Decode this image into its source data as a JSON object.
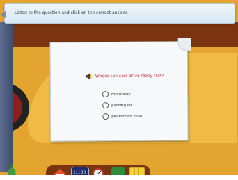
{
  "instruction": {
    "text": "Listen to the question and click on the correct answer."
  },
  "question": {
    "text": "Where can cars drive really fast?"
  },
  "options": [
    {
      "label": "motorway"
    },
    {
      "label": "parking lot"
    },
    {
      "label": "pedestrian zone"
    }
  ],
  "toolbar": {
    "clock_text": "11:00"
  },
  "colors": {
    "question_text": "#c3303c",
    "wall": "#7a3510",
    "floor": "#e3a52f"
  }
}
